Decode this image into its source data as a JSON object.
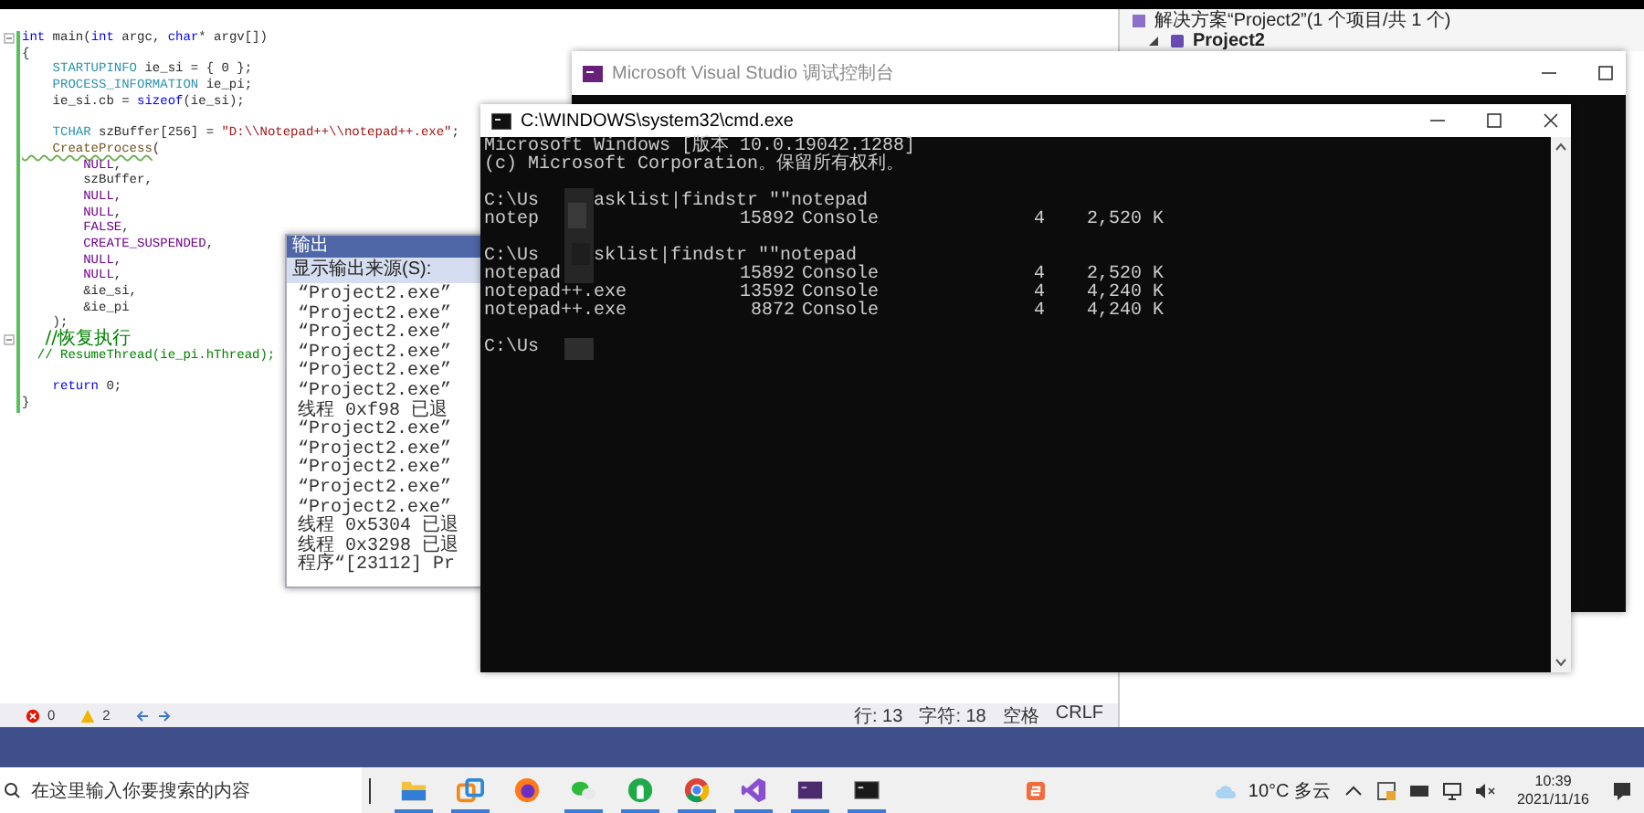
{
  "editor": {
    "lines": [
      {
        "fold": true,
        "segs": [
          {
            "text": "int",
            "kind": "keyword"
          },
          {
            "text": " main(",
            "kind": "plain"
          },
          {
            "text": "int",
            "kind": "keyword"
          },
          {
            "text": " argc, ",
            "kind": "plain"
          },
          {
            "text": "char",
            "kind": "keyword"
          },
          {
            "text": "* argv[])",
            "kind": "plain"
          }
        ]
      },
      {
        "fold": false,
        "segs": [
          {
            "text": "{",
            "kind": "plain"
          }
        ]
      },
      {
        "fold": false,
        "segs": [
          {
            "text": "    STARTUPINFO",
            "kind": "type"
          },
          {
            "text": " ie_si = { 0 };",
            "kind": "plain"
          }
        ]
      },
      {
        "fold": false,
        "segs": [
          {
            "text": "    PROCESS_INFORMATION",
            "kind": "type"
          },
          {
            "text": " ie_pi;",
            "kind": "plain"
          }
        ]
      },
      {
        "fold": false,
        "segs": [
          {
            "text": "    ie_si.cb = ",
            "kind": "plain"
          },
          {
            "text": "sizeof",
            "kind": "keyword"
          },
          {
            "text": "(ie_si);",
            "kind": "plain"
          }
        ]
      },
      {
        "fold": false
      },
      {
        "fold": false,
        "segs": [
          {
            "text": "    TCHAR",
            "kind": "type"
          },
          {
            "text": " szBuffer[256] = ",
            "kind": "plain"
          },
          {
            "text": "\"D:\\\\Notepad++\\\\notepad++.exe\"",
            "kind": "string"
          },
          {
            "text": ";",
            "kind": "plain"
          }
        ]
      },
      {
        "fold": false,
        "segs": [
          {
            "text": "    CreateProcess",
            "kind": "function"
          },
          {
            "text": "(",
            "kind": "plain"
          }
        ]
      },
      {
        "fold": false,
        "segs": [
          {
            "text": "        NULL",
            "kind": "macro"
          },
          {
            "text": ",",
            "kind": "plain"
          }
        ]
      },
      {
        "fold": false,
        "segs": [
          {
            "text": "        szBuffer,",
            "kind": "plain"
          }
        ]
      },
      {
        "fold": false,
        "segs": [
          {
            "text": "        NULL",
            "kind": "macro"
          },
          {
            "text": ",",
            "kind": "plain"
          }
        ]
      },
      {
        "fold": false,
        "segs": [
          {
            "text": "        NULL",
            "kind": "macro"
          },
          {
            "text": ",",
            "kind": "plain"
          }
        ]
      },
      {
        "fold": false,
        "segs": [
          {
            "text": "        FALSE",
            "kind": "macro"
          },
          {
            "text": ",",
            "kind": "plain"
          }
        ]
      },
      {
        "fold": false,
        "segs": [
          {
            "text": "        CREATE_SUSPENDED",
            "kind": "macro"
          },
          {
            "text": ",",
            "kind": "plain"
          }
        ]
      },
      {
        "fold": false,
        "segs": [
          {
            "text": "        NULL",
            "kind": "macro"
          },
          {
            "text": ",",
            "kind": "plain"
          }
        ]
      },
      {
        "fold": false,
        "segs": [
          {
            "text": "        NULL",
            "kind": "macro"
          },
          {
            "text": ",",
            "kind": "plain"
          }
        ]
      },
      {
        "fold": false,
        "segs": [
          {
            "text": "        &ie_si,",
            "kind": "plain"
          }
        ]
      },
      {
        "fold": false,
        "segs": [
          {
            "text": "        &ie_pi",
            "kind": "plain"
          }
        ]
      },
      {
        "fold": false,
        "segs": [
          {
            "text": "    );",
            "kind": "plain"
          }
        ]
      },
      {
        "fold": true,
        "segs": [
          {
            "text": "    //恢复执行",
            "kind": "wide-comment"
          }
        ]
      },
      {
        "fold": false,
        "segs": [
          {
            "text": "  // ResumeThread(ie_pi.hThread);",
            "kind": "comment"
          }
        ]
      },
      {
        "fold": false
      },
      {
        "fold": false,
        "segs": [
          {
            "text": "    return",
            "kind": "keyword"
          },
          {
            "text": " 0;",
            "kind": "plain"
          }
        ]
      },
      {
        "fold": false,
        "segs": [
          {
            "text": "}",
            "kind": "plain"
          }
        ]
      }
    ]
  },
  "status": {
    "errors": "0",
    "warnings": "2",
    "line": "行: 13",
    "char": "字符: 18",
    "indent": "空格",
    "eol": "CRLF"
  },
  "solution_explorer": {
    "header": "解决方案“Project2”(1 个项目/共 1 个)",
    "project": "Project2"
  },
  "output_panel": {
    "title": "输出",
    "source_label": "显示输出来源(S):",
    "lines": [
      "“Project2.exe”",
      "“Project2.exe”",
      "“Project2.exe”",
      "“Project2.exe”",
      "“Project2.exe”",
      "“Project2.exe”",
      "线程 0xf98 已退",
      "“Project2.exe”",
      "“Project2.exe”",
      "“Project2.exe”",
      "“Project2.exe”",
      "“Project2.exe”",
      "线程 0x5304 已退",
      "线程 0x3298 已退",
      "程序“[23112] Pr"
    ]
  },
  "debug_console": {
    "title": "Microsoft Visual Studio 调试控制台"
  },
  "cmd_window": {
    "title": "C:\\WINDOWS\\system32\\cmd.exe",
    "rows": [
      {
        "kind": "text",
        "text": "Microsoft Windows [版本 10.0.19042.1288]"
      },
      {
        "kind": "text",
        "text": "(c) Microsoft Corporation。保留所有权利。"
      },
      {
        "kind": "blank"
      },
      {
        "kind": "prompt",
        "prefix": "C:\\Us",
        "command": "asklist|findstr \"\"notepad"
      },
      {
        "kind": "process",
        "name": "notep",
        "pid": "15892",
        "type": "Console",
        "session": "4",
        "memory": "2,520 K"
      },
      {
        "kind": "blank"
      },
      {
        "kind": "prompt",
        "prefix": "C:\\Us",
        "command": "sklist|findstr \"\"notepad"
      },
      {
        "kind": "process",
        "name": "notepad",
        "pid": "15892",
        "type": "Console",
        "session": "4",
        "memory": "2,520 K"
      },
      {
        "kind": "process",
        "name": "notepad++.exe",
        "pid": "13592",
        "type": "Console",
        "session": "4",
        "memory": "4,240 K"
      },
      {
        "kind": "process",
        "name": "notepad++.exe",
        "pid": "8872",
        "type": "Console",
        "session": "4",
        "memory": "4,240 K"
      },
      {
        "kind": "blank"
      },
      {
        "kind": "prompt",
        "prefix": "C:\\Us"
      }
    ]
  },
  "taskbar": {
    "search_placeholder": "在这里输入你要搜索的内容",
    "apps": [
      {
        "kind": "folder",
        "running": true
      },
      {
        "kind": "windows",
        "running": true
      },
      {
        "kind": "globe",
        "running": false
      },
      {
        "kind": "chat",
        "running": true
      },
      {
        "kind": "circle",
        "running": true
      },
      {
        "kind": "ring",
        "running": true
      },
      {
        "kind": "ribbon",
        "running": true
      },
      {
        "kind": "terminal",
        "running": true
      },
      {
        "kind": "console",
        "running": true
      }
    ],
    "weather": "10°C 多云",
    "time": "10:39",
    "date": "2021/11/16"
  }
}
